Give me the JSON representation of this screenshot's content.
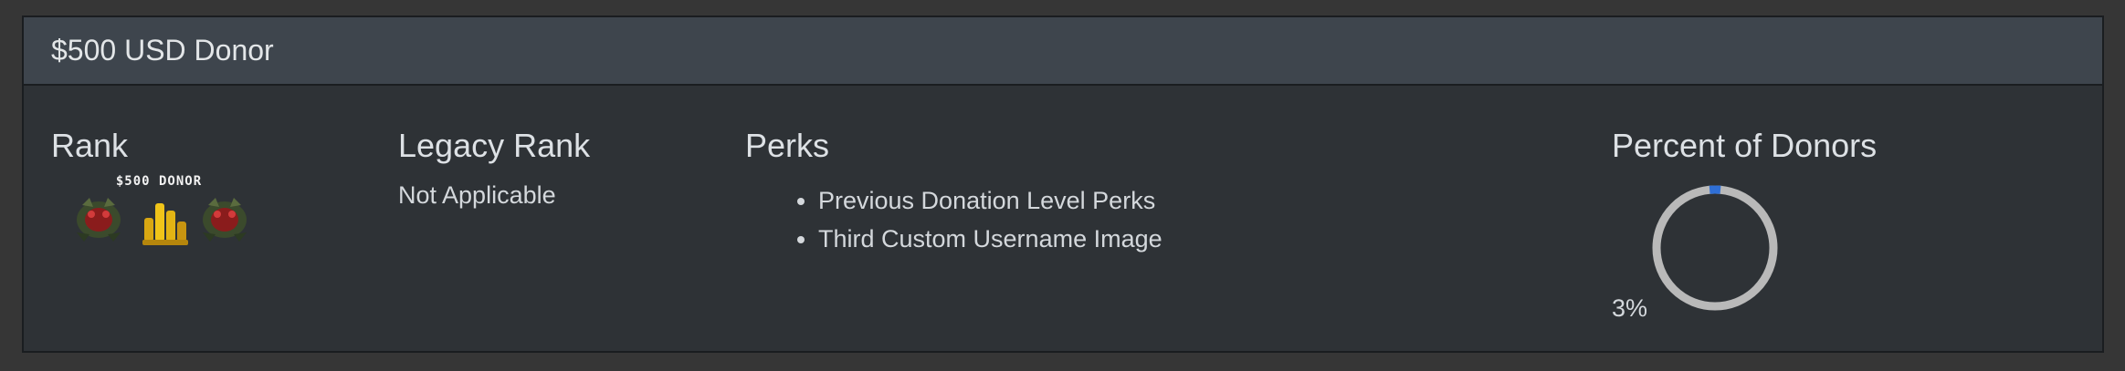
{
  "panel": {
    "title": "$500 USD Donor"
  },
  "rank": {
    "heading": "Rank",
    "badge_text": "$500 DONOR",
    "badge_icon": "donor-rank-badge-icon"
  },
  "legacy_rank": {
    "heading": "Legacy Rank",
    "value": "Not Applicable"
  },
  "perks": {
    "heading": "Perks",
    "items": [
      "Previous Donation Level Perks",
      "Third Custom Username Image"
    ]
  },
  "percent_of_donors": {
    "heading": "Percent of Donors",
    "value_label": "3%",
    "fraction": 0.03,
    "ring_color": "#b9b9b9",
    "fill_color": "#2f6fd6"
  },
  "colors": {
    "page_bg": "#363636",
    "panel_bg": "#2e3236",
    "header_bg": "#3e454d",
    "text": "#d4d8dc"
  }
}
